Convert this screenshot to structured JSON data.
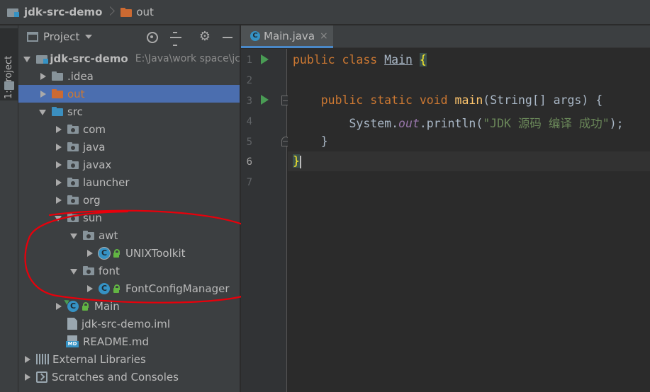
{
  "breadcrumb": {
    "project": "jdk-src-demo",
    "folder": "out"
  },
  "toolstrip": {
    "project_tab_label": "1: Project"
  },
  "project_panel": {
    "title": "Project",
    "tree": [
      {
        "label": "jdk-src-demo",
        "path": "E:\\Java\\work space\\jc",
        "expanded": true
      },
      {
        "label": ".idea",
        "expanded": false
      },
      {
        "label": "out",
        "expanded": false,
        "selected": true
      },
      {
        "label": "src",
        "expanded": true
      },
      {
        "label": "com",
        "expanded": false
      },
      {
        "label": "java",
        "expanded": false
      },
      {
        "label": "javax",
        "expanded": false
      },
      {
        "label": "launcher",
        "expanded": false
      },
      {
        "label": "org",
        "expanded": false
      },
      {
        "label": "sun",
        "expanded": true
      },
      {
        "label": "awt",
        "expanded": true
      },
      {
        "label": "UNIXToolkit",
        "expanded": false
      },
      {
        "label": "font",
        "expanded": true
      },
      {
        "label": "FontConfigManager",
        "expanded": false
      },
      {
        "label": "Main",
        "expanded": false
      },
      {
        "label": "jdk-src-demo.iml"
      },
      {
        "label": "README.md"
      },
      {
        "label": "External Libraries",
        "expanded": false
      },
      {
        "label": "Scratches and Consoles",
        "expanded": false
      }
    ]
  },
  "editor": {
    "tab_label": "Main.java",
    "tab_close": "×",
    "line_numbers": [
      "1",
      "2",
      "3",
      "4",
      "5",
      "6",
      "7"
    ],
    "code": {
      "l1_kw1": "public",
      "l1_kw2": "class",
      "l1_name": "Main",
      "l1_brace": "{",
      "l3_kw1": "public",
      "l3_kw2": "static",
      "l3_kw3": "void",
      "l3_fn": "main",
      "l3_rest": "(String[] args) {",
      "l4_pre": "System.",
      "l4_field": "out",
      "l4_call": ".println(",
      "l4_str": "\"JDK 源码 编译 成功\"",
      "l4_post": ");",
      "l5_brace": "}",
      "l6_brace": "}"
    }
  },
  "colors": {
    "selection": "#4b6eaf",
    "keyword": "#cc7832",
    "string": "#6a8759",
    "function": "#ffc66d",
    "annotation": "#e8000b"
  }
}
